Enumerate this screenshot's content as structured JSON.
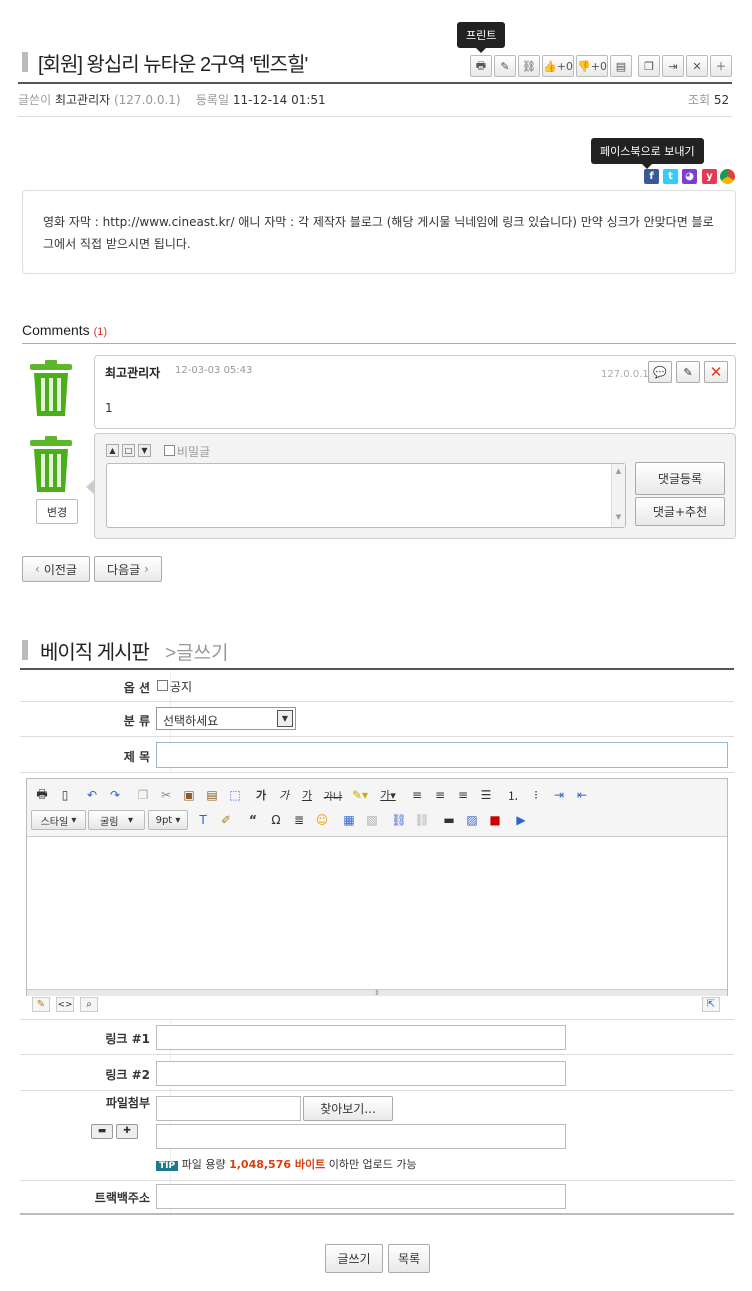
{
  "post": {
    "print_tooltip": "프린트",
    "title": "[회원] 왕십리 뉴타운 2구역 '텐즈힐'",
    "author_label": "글쓴이",
    "author": "최고관리자",
    "author_ip": "(127.0.0.1)",
    "date_label": "등록일",
    "date": "11-12-14 01:51",
    "views_label": "조회",
    "views": "52",
    "recommend_count": "+0",
    "oppose_count": "+0",
    "facebook_tooltip": "페이스북으로 보내기",
    "content": "영화 자막 : http://www.cineast.kr/ 애니 자막 : 각 제작자 블로그 (해당 게시물 닉네임에 링크 있습니다) 만약 싱크가 안맞다면 블로그에서 직접 받으시면 됩니다."
  },
  "comments": {
    "heading": "Comments",
    "count": "(1)",
    "items": [
      {
        "author": "최고관리자",
        "date": "12-03-03 05:43",
        "ip": "127.0.0.1",
        "text": "1"
      }
    ],
    "secret_label": "비밀글",
    "change_button": "변경",
    "submit_button": "댓글등록",
    "submit_recommend_button": "댓글+추천"
  },
  "nav": {
    "prev": "이전글",
    "next": "다음글"
  },
  "write": {
    "board_name": "베이직 게시판",
    "subtitle": ">글쓰기",
    "option_label": "옵 션",
    "notice_label": "공지",
    "category_label": "분 류",
    "category_value": "선택하세요",
    "subject_label": "제 목",
    "editor": {
      "style_select": "스타일",
      "font_select": "굴림",
      "size_select": "9pt"
    },
    "link1_label": "링크 #1",
    "link2_label": "링크 #2",
    "file_label": "파일첨부",
    "browse_button": "찾아보기...",
    "tip_badge": "TIP",
    "tip_text_before": "파일 용량",
    "tip_size": "1,048,576 바이트",
    "tip_text_after": "이하만 업로드 가능",
    "trackback_label": "트랙백주소",
    "submit_button": "글쓰기",
    "list_button": "목록"
  },
  "colors": {
    "accent_red": "#d9400f",
    "tip_badge": "#1b7a8c",
    "trash_green": "#4caf1a"
  }
}
